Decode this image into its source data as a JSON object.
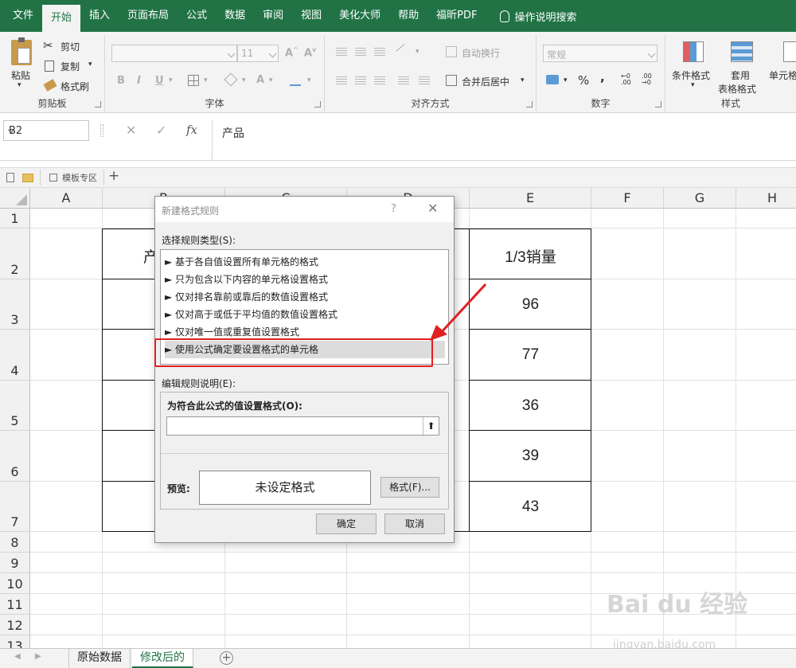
{
  "menu": {
    "tabs": [
      "文件",
      "开始",
      "插入",
      "页面布局",
      "公式",
      "数据",
      "审阅",
      "视图",
      "美化大师",
      "帮助",
      "福昕PDF"
    ],
    "active": "开始",
    "tell_me": "操作说明搜索"
  },
  "ribbon": {
    "clipboard": {
      "label": "剪贴板",
      "paste": "粘贴",
      "cut": "剪切",
      "copy": "复制",
      "painter": "格式刷"
    },
    "font": {
      "label": "字体",
      "size": "11",
      "bold": "B",
      "italic": "I",
      "underline": "U"
    },
    "align": {
      "label": "对齐方式",
      "wrap": "自动换行",
      "merge": "合并后居中"
    },
    "number": {
      "label": "数字",
      "format": "常规",
      "percent": "%",
      "comma": ","
    },
    "styles": {
      "label": "样式",
      "cond": "条件格式",
      "table_a": "套用",
      "table_b": "表格格式",
      "cell": "单元格"
    }
  },
  "formula_bar": {
    "name_box": "B2",
    "fx": "fx",
    "content": "产品"
  },
  "doc_tab": {
    "label": "模板专区"
  },
  "grid": {
    "columns": [
      "A",
      "B",
      "C",
      "D",
      "E",
      "F",
      "G",
      "H"
    ],
    "rows": [
      "1",
      "2",
      "3",
      "4",
      "5",
      "6",
      "7",
      "8",
      "9",
      "10",
      "11",
      "12",
      "13"
    ],
    "header_b": "产",
    "header_e": "1/3销量",
    "values_e": [
      "96",
      "77",
      "36",
      "39",
      "43"
    ]
  },
  "sheets": [
    "原始数据",
    "修改后的"
  ],
  "active_sheet": "修改后的",
  "dialog": {
    "title": "新建格式规则",
    "help": "?",
    "close": "✕",
    "select_label": "选择规则类型(S):",
    "rules": [
      "► 基于各自值设置所有单元格的格式",
      "► 只为包含以下内容的单元格设置格式",
      "► 仅对排名靠前或靠后的数值设置格式",
      "► 仅对高于或低于平均值的数值设置格式",
      "► 仅对唯一值或重复值设置格式",
      "► 使用公式确定要设置格式的单元格"
    ],
    "selected_rule_index": 5,
    "edit_label": "编辑规则说明(E):",
    "formula_label": "为符合此公式的值设置格式(O):",
    "formula_value": "",
    "preview_label": "预览:",
    "preview_text": "未设定格式",
    "format_button": "格式(F)...",
    "ok_button": "确定",
    "cancel_button": "取消"
  },
  "watermark": {
    "main": "Bai du 经验",
    "sub": "jingyan.baidu.com"
  },
  "colors": {
    "accent": "#217346",
    "annotation": "#e02020"
  }
}
